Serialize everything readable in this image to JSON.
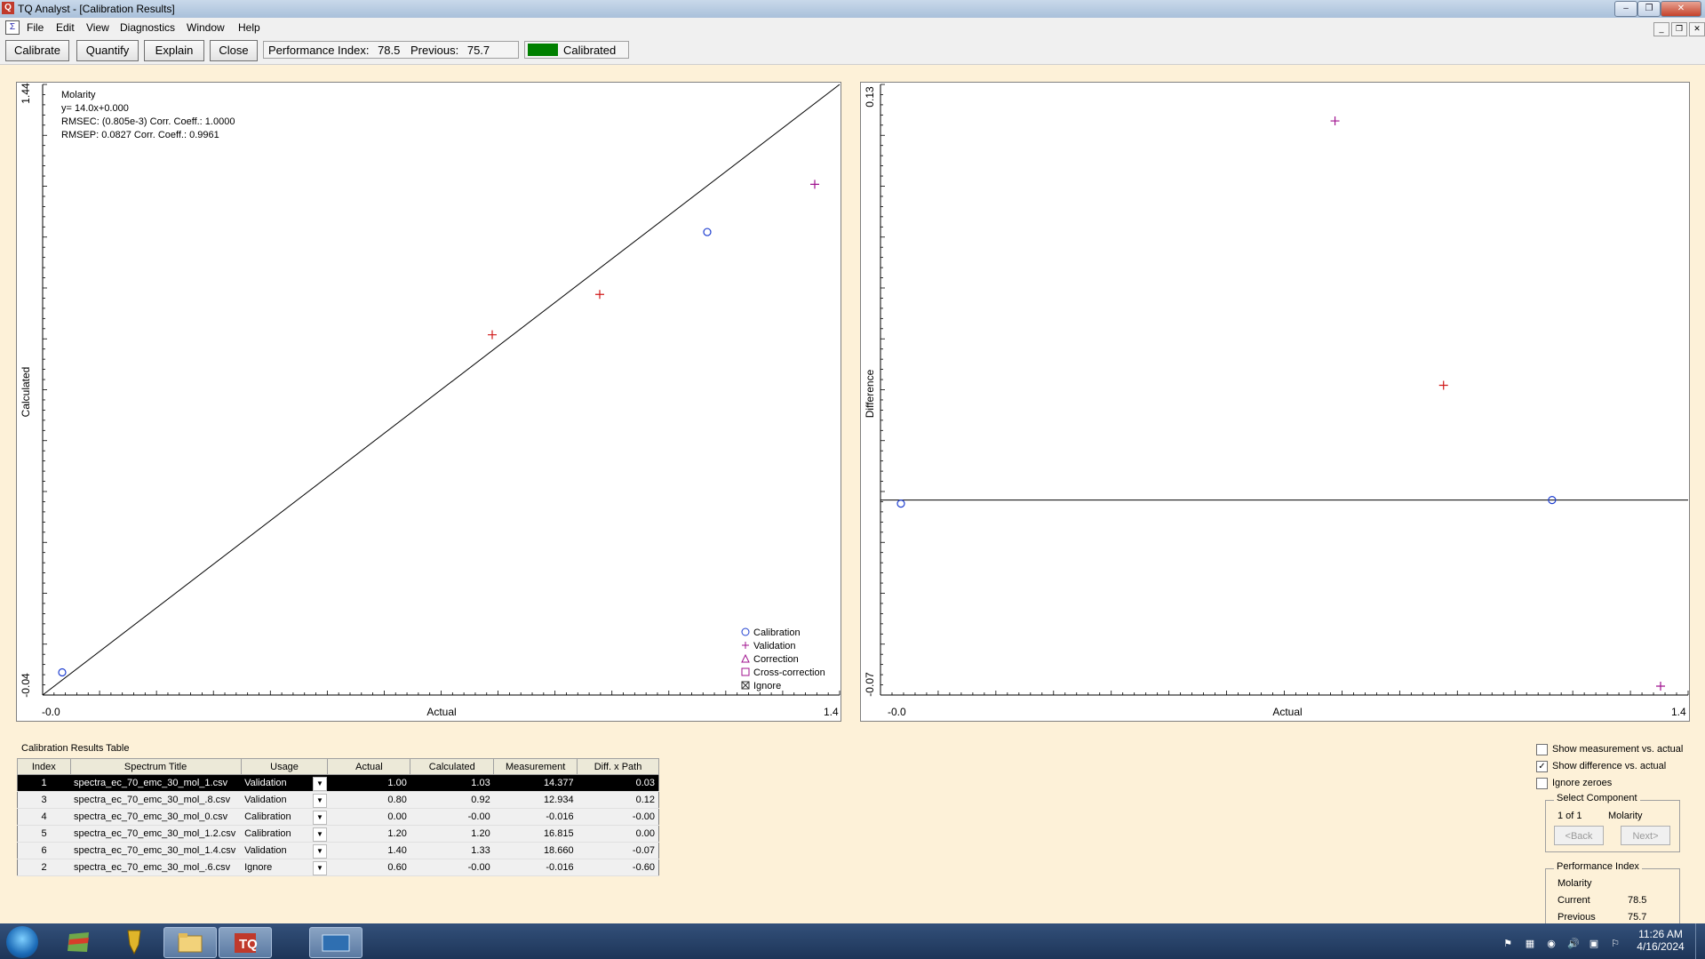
{
  "window": {
    "title": "TQ Analyst  - [Calibration Results]",
    "app_icon": "tq-analyst-icon",
    "controls": [
      "minimize-icon",
      "restore-icon",
      "close-icon"
    ]
  },
  "menu": {
    "items": [
      "File",
      "Edit",
      "View",
      "Diagnostics",
      "Window",
      "Help"
    ],
    "mdi_controls": [
      "minimize-icon",
      "restore-icon",
      "close-icon"
    ]
  },
  "toolbar": {
    "calibrate": "Calibrate",
    "quantify": "Quantify",
    "explain": "Explain",
    "close": "Close",
    "performance_label": "Performance Index:",
    "performance_value": "78.5",
    "previous_label": "Previous:",
    "previous_value": "75.7",
    "status_label": "Calibrated",
    "status_color": "#008000"
  },
  "left_plot": {
    "component": "Molarity",
    "equation": "y=  14.0x+0.000",
    "rmsec": "RMSEC: (0.805e-3)   Corr. Coeff.: 1.0000",
    "rmsep": "RMSEP: 0.0827   Corr. Coeff.: 0.9961",
    "y_label": "Calculated",
    "x_label": "Actual",
    "y_max_label": "1.44",
    "y_min_label": "-0.04",
    "x_min_label": "-0.0",
    "x_max_label": "1.4",
    "legend": [
      "Calibration",
      "Validation",
      "Correction",
      "Cross-correction",
      "Ignore"
    ]
  },
  "right_plot": {
    "y_label": "Difference",
    "x_label": "Actual",
    "y_max_label": "0.13",
    "y_min_label": "-0.07",
    "x_min_label": "-0.0",
    "x_max_label": "1.4"
  },
  "chart_data": [
    {
      "type": "scatter",
      "xlabel": "Actual",
      "ylabel": "Calculated",
      "xlim": [
        0.0,
        1.4
      ],
      "ylim": [
        -0.04,
        1.44
      ],
      "series": [
        {
          "name": "Calibration",
          "marker": "circle",
          "color": "#1f3fd0",
          "points": [
            [
              0.0,
              0.0
            ],
            [
              1.2,
              1.2
            ]
          ]
        },
        {
          "name": "Validation",
          "marker": "plus",
          "color": "#a0138f",
          "points": [
            [
              1.4,
              1.33
            ]
          ]
        },
        {
          "name": "Validation",
          "marker": "plus",
          "color": "#d01a1a",
          "points": [
            [
              0.8,
              0.92
            ],
            [
              1.0,
              1.03
            ]
          ]
        }
      ],
      "fit_line": {
        "slope": 1.0,
        "intercept": 0.0
      }
    },
    {
      "type": "scatter",
      "xlabel": "Actual",
      "ylabel": "Difference",
      "xlim": [
        0.0,
        1.4
      ],
      "ylim": [
        -0.07,
        0.13
      ],
      "series": [
        {
          "name": "Calibration",
          "marker": "circle",
          "color": "#1f3fd0",
          "points": [
            [
              0.0,
              0.0
            ],
            [
              1.2,
              0.0
            ]
          ]
        },
        {
          "name": "Validation",
          "marker": "plus",
          "color": "#a0138f",
          "points": [
            [
              0.8,
              0.12
            ],
            [
              1.4,
              -0.07
            ]
          ]
        },
        {
          "name": "Validation",
          "marker": "plus",
          "color": "#d01a1a",
          "points": [
            [
              1.0,
              0.03
            ]
          ]
        }
      ],
      "zero_line": 0.0
    }
  ],
  "table": {
    "caption": "Calibration Results Table",
    "headers": [
      "Index",
      "Spectrum Title",
      "Usage",
      "Actual",
      "Calculated",
      "Measurement",
      "Diff. x Path"
    ],
    "rows": [
      {
        "index": "1",
        "title": "spectra_ec_70_emc_30_mol_1.csv",
        "usage": "Validation",
        "actual": "1.00",
        "calculated": "1.03",
        "measurement": "14.377",
        "diff": "0.03",
        "selected": true
      },
      {
        "index": "3",
        "title": "spectra_ec_70_emc_30_mol_.8.csv",
        "usage": "Validation",
        "actual": "0.80",
        "calculated": "0.92",
        "measurement": "12.934",
        "diff": "0.12"
      },
      {
        "index": "4",
        "title": "spectra_ec_70_emc_30_mol_0.csv",
        "usage": "Calibration",
        "actual": "0.00",
        "calculated": "-0.00",
        "measurement": "-0.016",
        "diff": "-0.00"
      },
      {
        "index": "5",
        "title": "spectra_ec_70_emc_30_mol_1.2.csv",
        "usage": "Calibration",
        "actual": "1.20",
        "calculated": "1.20",
        "measurement": "16.815",
        "diff": "0.00"
      },
      {
        "index": "6",
        "title": "spectra_ec_70_emc_30_mol_1.4.csv",
        "usage": "Validation",
        "actual": "1.40",
        "calculated": "1.33",
        "measurement": "18.660",
        "diff": "-0.07"
      },
      {
        "index": "2",
        "title": "spectra_ec_70_emc_30_mol_.6.csv",
        "usage": "Ignore",
        "actual": "0.60",
        "calculated": "-0.00",
        "measurement": "-0.016",
        "diff": "-0.60"
      }
    ]
  },
  "options": {
    "show_measurement": {
      "label": "Show measurement vs. actual",
      "checked": false
    },
    "show_difference": {
      "label": "Show difference vs. actual",
      "checked": true
    },
    "ignore_zeroes": {
      "label": "Ignore zeroes",
      "checked": false
    }
  },
  "select_component": {
    "title": "Select Component",
    "position": "1 of 1",
    "name": "Molarity",
    "back": "<Back",
    "next": "Next>"
  },
  "performance_panel": {
    "title": "Performance Index",
    "component": "Molarity",
    "current_label": "Current",
    "current_value": "78.5",
    "previous_label": "Previous",
    "previous_value": "75.7"
  },
  "taskbar": {
    "apps": [
      "windows-explorer-icon",
      "app-icon-gold",
      "folder-icon",
      "tq-analyst-icon",
      "display-icon"
    ],
    "time": "11:26 AM",
    "date": "4/16/2024"
  }
}
